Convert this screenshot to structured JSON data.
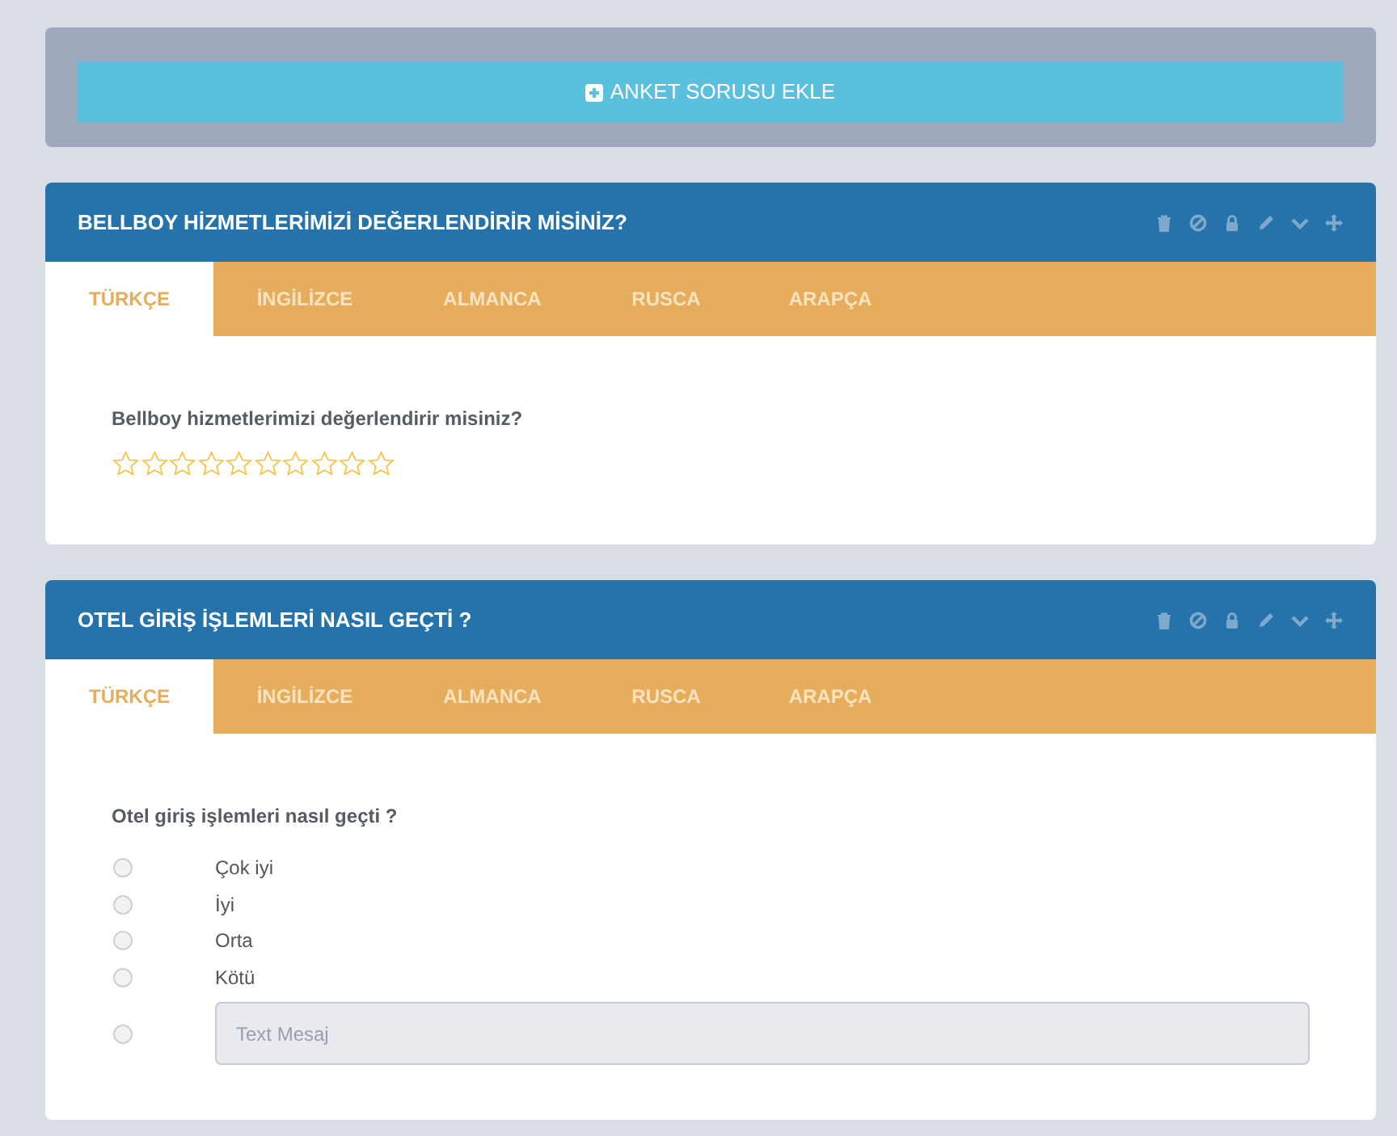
{
  "add_button": {
    "label": "ANKET SORUSU EKLE"
  },
  "questions": [
    {
      "title": "BELLBOY HİZMETLERİMİZİ DEĞERLENDİRİR MİSİNİZ?",
      "tabs": [
        {
          "label": "TÜRKÇE",
          "selected": true
        },
        {
          "label": "İNGİLİZCE",
          "selected": false
        },
        {
          "label": "ALMANCA",
          "selected": false
        },
        {
          "label": "RUSCA",
          "selected": false
        },
        {
          "label": "ARAPÇA",
          "selected": false
        }
      ],
      "kind": "rating",
      "question": "Bellboy hizmetlerimizi değerlendirir misiniz?",
      "stars": 0
    },
    {
      "title": "OTEL GİRİŞ İŞLEMLERİ NASIL GEÇTİ ?",
      "tabs": [
        {
          "label": "TÜRKÇE",
          "selected": true
        },
        {
          "label": "İNGİLİZCE",
          "selected": false
        },
        {
          "label": "ALMANCA",
          "selected": false
        },
        {
          "label": "RUSCA",
          "selected": false
        },
        {
          "label": "ARAPÇA",
          "selected": false
        }
      ],
      "kind": "choice",
      "question": "Otel giriş işlemleri nasıl geçti ?",
      "options": [
        {
          "kind": "label",
          "label": "Çok iyi",
          "selected": false
        },
        {
          "kind": "label",
          "label": "İyi",
          "selected": false
        },
        {
          "kind": "label",
          "label": "Orta",
          "selected": false
        },
        {
          "kind": "label",
          "label": "Kötü",
          "selected": false
        },
        {
          "kind": "text",
          "placeholder": "Text Mesaj",
          "selected": false
        }
      ]
    }
  ]
}
